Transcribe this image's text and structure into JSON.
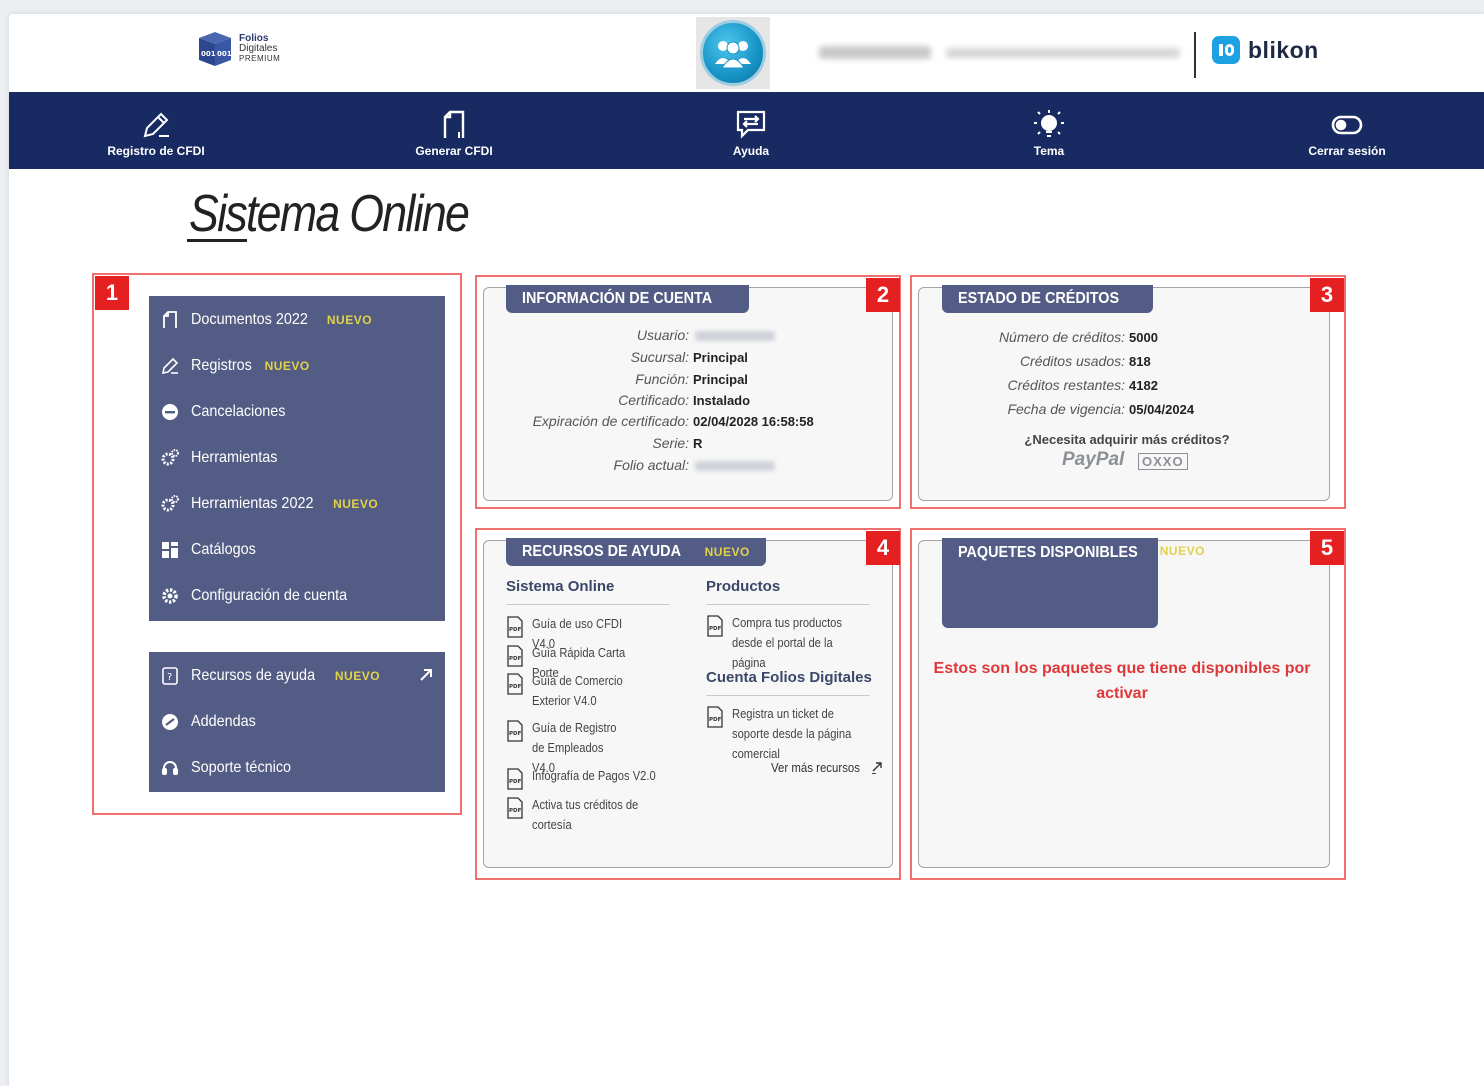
{
  "header": {
    "logo_line1": "Folios",
    "logo_line2": "Digitales",
    "logo_line3": "PREMIUM",
    "blikon": "blikon"
  },
  "nav": [
    {
      "label": "Registro de CFDI",
      "icon": "pencil-icon"
    },
    {
      "label": "Generar CFDI",
      "icon": "document-icon"
    },
    {
      "label": "Ayuda",
      "icon": "chat-icon"
    },
    {
      "label": "Tema",
      "icon": "bulb-icon"
    },
    {
      "label": "Cerrar sesión",
      "icon": "toggle-icon"
    }
  ],
  "page_title": "Sistema Online",
  "badges": [
    "1",
    "2",
    "3",
    "4",
    "5"
  ],
  "menu_main": [
    {
      "label": "Documentos 2022",
      "nuevo": "NUEVO",
      "icon": "document-icon"
    },
    {
      "label": "Registros",
      "nuevo": "NUEVO",
      "icon": "pencil-icon"
    },
    {
      "label": "Cancelaciones",
      "nuevo": "",
      "icon": "minus-circle-icon"
    },
    {
      "label": "Herramientas",
      "nuevo": "",
      "icon": "gears-icon"
    },
    {
      "label": "Herramientas 2022",
      "nuevo": "NUEVO",
      "icon": "gears-icon"
    },
    {
      "label": "Catálogos",
      "nuevo": "",
      "icon": "grid-icon"
    },
    {
      "label": "Configuración de cuenta",
      "nuevo": "",
      "icon": "gear-icon"
    }
  ],
  "menu_secondary": [
    {
      "label": "Recursos de ayuda",
      "nuevo": "NUEVO",
      "icon": "help-doc-icon"
    },
    {
      "label": "Addendas",
      "nuevo": "",
      "icon": "slash-circle-icon"
    },
    {
      "label": "Soporte técnico",
      "nuevo": "",
      "icon": "headset-icon"
    }
  ],
  "cuenta": {
    "title": "INFORMACIÓN DE CUENTA",
    "rows": [
      {
        "k": "Usuario:",
        "v": ""
      },
      {
        "k": "Sucursal:",
        "v": "Principal"
      },
      {
        "k": "Función:",
        "v": "Principal"
      },
      {
        "k": "Certificado:",
        "v": "Instalado"
      },
      {
        "k": "Expiración de certificado:",
        "v": "02/04/2028 16:58:58"
      },
      {
        "k": "Serie:",
        "v": "R"
      },
      {
        "k": "Folio actual:",
        "v": ""
      }
    ]
  },
  "creditos": {
    "title": "ESTADO DE CRÉDITOS",
    "rows": [
      {
        "k": "Número de créditos:",
        "v": "5000"
      },
      {
        "k": "Créditos usados:",
        "v": "818"
      },
      {
        "k": "Créditos restantes:",
        "v": "4182"
      },
      {
        "k": "Fecha de vigencia:",
        "v": "05/04/2024"
      }
    ],
    "question": "¿Necesita adquirir más créditos?",
    "paypal": "PayPal",
    "oxxo": "OXXO"
  },
  "recursos": {
    "title": "RECURSOS DE AYUDA",
    "nuevo": "NUEVO",
    "col1_head": "Sistema Online",
    "col1": [
      "Guía de uso CFDI V4.0",
      "Guía Rápida Carta Porte",
      "Guía de Comercio Exterior V4.0",
      "Guía de Registro de Empleados V4.0",
      "Infografía de Pagos V2.0",
      "Activa tus créditos de cortesía"
    ],
    "col2_head": "Productos",
    "col2": [
      "Compra tus productos desde el portal de la página"
    ],
    "col3_head": "Cuenta Folios Digitales",
    "col3": [
      "Registra un ticket de soporte desde la página comercial"
    ],
    "ver_mas": "Ver más recursos"
  },
  "paquetes": {
    "title": "PAQUETES DISPONIBLES",
    "nuevo": "NUEVO",
    "message": "Estos son los paquetes que tiene disponibles por activar"
  },
  "colors": {
    "navy": "#182a62",
    "menu": "#535c84",
    "accent_red": "#e52020",
    "nuevo": "#e2d24a"
  }
}
